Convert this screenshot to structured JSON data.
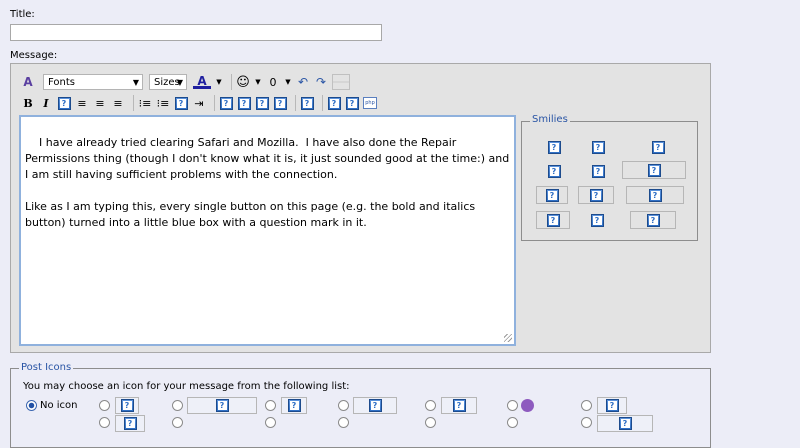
{
  "form": {
    "title_label": "Title:",
    "message_label": "Message:"
  },
  "toolbar": {
    "font_select": "Fonts",
    "size_select": "Sizes",
    "bold": "B",
    "italic": "I",
    "text_color": "A"
  },
  "message": {
    "text": "I have already tried clearing Safari and Mozilla.  I have also done the Repair Permissions thing (though I don't know what it is, it just sounded good at the time:) and I am still having sufficient problems with the connection.\n\nLike as I am typing this, every single button on this page (e.g. the bold and italics button) turned into a little blue box with a question mark in it."
  },
  "smilies": {
    "legend": "Smilies",
    "placeholder": "?"
  },
  "post_icons": {
    "legend": "Post Icons",
    "description": "You may choose an icon for your message from the following list:",
    "no_icon_label": "No icon"
  },
  "colors": {
    "background": "#ecedf7",
    "panel": "#e3e3e3",
    "legend_blue": "#2a55a5",
    "broken_icon_blue": "#2f6fc5"
  }
}
